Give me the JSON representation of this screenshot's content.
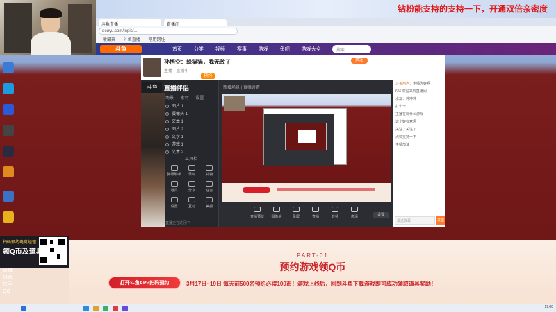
{
  "top_banner": {
    "message": "钻粉能支持的支持一下，开通双倍亲密度"
  },
  "browser": {
    "tab1": "斗鱼直播",
    "tab2": "直播间",
    "address": "douyu.com/topic/...",
    "bookmarks": [
      "收藏夹",
      "斗鱼直播",
      "常用网址"
    ],
    "search_placeholder": "搜索"
  },
  "site_nav": {
    "logo": "斗鱼",
    "items": [
      "首页",
      "分类",
      "视频",
      "赛事",
      "游戏",
      "鱼吧",
      "游戏大全"
    ]
  },
  "room": {
    "title": "孙悟空：躲猫猫，我无敌了",
    "meta": "主播 · 直播中",
    "badge": "预约",
    "follow_label": "关注"
  },
  "recorder": {
    "logo": "斗鱼",
    "brand": "直播伴侣",
    "tabs": [
      "场景",
      "素材",
      "设置"
    ],
    "scenes": [
      "图片 1",
      "摄像头 1",
      "文本 1",
      "图片 2",
      "文字 1",
      "游戏 1",
      "文本 2"
    ],
    "tools_title": "工具栏",
    "tools": [
      "弹幕助手",
      "录制",
      "礼物",
      "道具",
      "分享",
      "任务",
      "设置",
      "互动",
      "美颜"
    ],
    "status": "直播正在进行中",
    "top_info": "新增场景  |  直播设置",
    "controls": [
      "直播预览",
      "摄像头",
      "录屏",
      "直播",
      "音频",
      "高清"
    ],
    "settings_label": "设置"
  },
  "chat": {
    "lines": [
      "主播你好啊",
      "666 欢迎来到直播间",
      "水友：冲冲冲",
      "打个卡",
      "主播在玩什么游戏",
      "这个好有意思",
      "关注了关注了",
      "点赞支持一下",
      "主播加油"
    ],
    "highlight_user": "斗鱼用户",
    "input_placeholder": "发送弹幕",
    "send_label": "发送"
  },
  "promo": {
    "part": "PART-01",
    "heading": "预约游戏领Q币",
    "button": "打开斗鱼APP扫码预约",
    "description": "3月17日~19日 每天前500名预约必得100币！游戏上线后，回到斗鱼下载游戏即可成功领取道具奖励！"
  },
  "qr_card": {
    "line1": "扫码预约电竞经理",
    "line2": "领Q币及道具"
  },
  "sidebar_list": [
    "直播",
    "抖音",
    "快手",
    "QQ"
  ],
  "tray": {
    "time": "19:00"
  }
}
